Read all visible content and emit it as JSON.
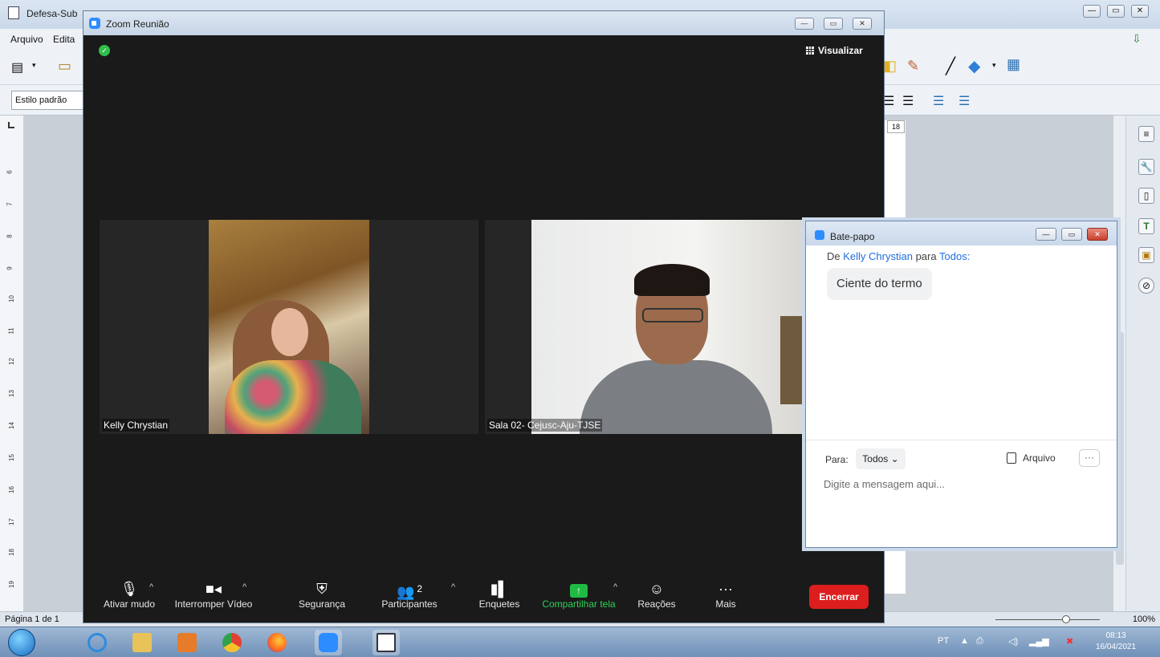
{
  "writer": {
    "title": "Defesa-Sub",
    "menu": [
      "Arquivo",
      "Edita"
    ],
    "style_box": "Estilo padrão",
    "page_number": "18",
    "ruler_marks": [
      "6",
      "7",
      "8",
      "9",
      "10",
      "11",
      "12",
      "13",
      "14",
      "15",
      "16",
      "17",
      "18",
      "19"
    ],
    "status_page": "Página 1 de 1",
    "zoom": "100%"
  },
  "zoom_window": {
    "title": "Zoom Reunião",
    "view_label": "Visualizar",
    "participants": [
      {
        "name": "Kelly Chrystian"
      },
      {
        "name": "Sala 02- Cejusc-Aju-TJSE"
      }
    ],
    "toolbar": {
      "mute": "Ativar mudo",
      "video": "Interromper Vídeo",
      "security": "Segurança",
      "participants": "Participantes",
      "participants_count": "2",
      "polls": "Enquetes",
      "share": "Compartilhar tela",
      "reactions": "Reações",
      "more": "Mais",
      "end": "Encerrar"
    }
  },
  "chat": {
    "title": "Bate-papo",
    "from_prefix": "De",
    "from": "Kelly Chrystian",
    "to_prefix": "para",
    "to": "Todos:",
    "message": "Ciente do termo",
    "to_label": "Para:",
    "recipient": "Todos",
    "file_label": "Arquivo",
    "more_label": "···",
    "input_placeholder": "Digite a mensagem aqui..."
  },
  "taskbar": {
    "lang": "PT",
    "time": "08:13",
    "date": "16/04/2021"
  }
}
